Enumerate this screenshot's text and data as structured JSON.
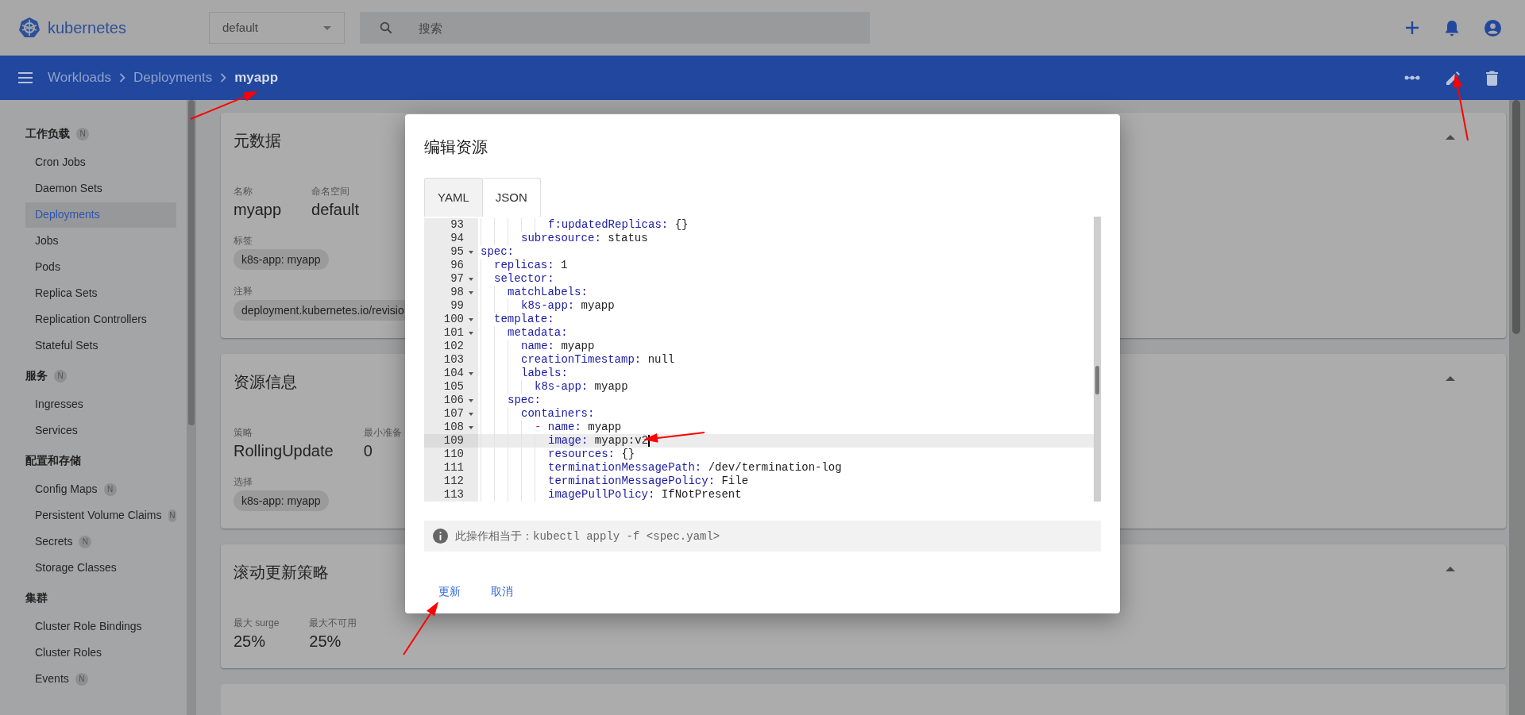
{
  "header": {
    "logo_text": "kubernetes",
    "namespace": "default",
    "search": {
      "placeholder": "搜索"
    }
  },
  "toolbar": {
    "breadcrumbs": [
      {
        "label": "Workloads",
        "current": false
      },
      {
        "label": "Deployments",
        "current": false
      },
      {
        "label": "myapp",
        "current": true
      }
    ]
  },
  "sidebar": {
    "sections": [
      {
        "title": "工作负载",
        "badge": "N",
        "items": [
          {
            "label": "Cron Jobs",
            "selected": false
          },
          {
            "label": "Daemon Sets",
            "selected": false
          },
          {
            "label": "Deployments",
            "selected": true
          },
          {
            "label": "Jobs",
            "selected": false
          },
          {
            "label": "Pods",
            "selected": false
          },
          {
            "label": "Replica Sets",
            "selected": false
          },
          {
            "label": "Replication Controllers",
            "selected": false
          },
          {
            "label": "Stateful Sets",
            "selected": false
          }
        ]
      },
      {
        "title": "服务",
        "badge": "N",
        "items": [
          {
            "label": "Ingresses",
            "selected": false
          },
          {
            "label": "Services",
            "selected": false
          }
        ]
      },
      {
        "title": "配置和存储",
        "items": [
          {
            "label": "Config Maps",
            "selected": false,
            "badge": "N"
          },
          {
            "label": "Persistent Volume Claims",
            "selected": false,
            "badge": "N"
          },
          {
            "label": "Secrets",
            "selected": false,
            "badge": "N"
          },
          {
            "label": "Storage Classes",
            "selected": false
          }
        ]
      },
      {
        "title": "集群",
        "items": [
          {
            "label": "Cluster Role Bindings",
            "selected": false
          },
          {
            "label": "Cluster Roles",
            "selected": false
          },
          {
            "label": "Events",
            "selected": false,
            "badge": "N"
          }
        ]
      }
    ]
  },
  "cards": [
    {
      "title": "元数据",
      "fields": [
        {
          "label": "名称",
          "value": "myapp"
        },
        {
          "label": "命名空间",
          "value": "default"
        }
      ],
      "chip_groups": [
        {
          "label": "标签",
          "chips": [
            "k8s-app: myapp"
          ]
        },
        {
          "label": "注释",
          "chips": [
            "deployment.kubernetes.io/revisio"
          ]
        }
      ]
    },
    {
      "title": "资源信息",
      "fields": [
        {
          "label": "策略",
          "value": "RollingUpdate"
        },
        {
          "label": "最小准备",
          "value": "0"
        }
      ],
      "chip_groups": [
        {
          "label": "选择",
          "chips": [
            "k8s-app: myapp"
          ]
        }
      ]
    },
    {
      "title": "滚动更新策略",
      "fields": [
        {
          "label": "最大 surge",
          "value": "25%"
        },
        {
          "label": "最大不可用",
          "value": "25%"
        }
      ]
    }
  ],
  "dialog": {
    "title": "编辑资源",
    "tabs": [
      {
        "label": "YAML",
        "selected": false
      },
      {
        "label": "JSON",
        "selected": true
      }
    ],
    "lines": [
      {
        "children": [
          {
            "children": [
              {
                "children": [
                  {
                    "children": [
                      {
                        "children": [
                          {
                            "num": "93",
                            "key": "f:updatedReplicas:",
                            "value": "{}",
                            "fold": false,
                            "selected": false
                          }
                        ]
                      }
                    ]
                  },
                  {
                    "num": "94",
                    "key": "subresource:",
                    "value": "status",
                    "fold": false,
                    "selected": false
                  }
                ]
              }
            ]
          }
        ]
      },
      {
        "num": "95",
        "key": "spec:",
        "fold": true,
        "selected": false,
        "children": [
          {
            "num": "96",
            "key": "replicas:",
            "value": "1",
            "fold": false,
            "selected": false
          },
          {
            "num": "97",
            "key": "selector:",
            "fold": true,
            "selected": false,
            "children": [
              {
                "num": "98",
                "key": "matchLabels:",
                "fold": true,
                "selected": false,
                "children": [
                  {
                    "num": "99",
                    "key": "k8s-app:",
                    "value": "myapp",
                    "fold": false,
                    "selected": false
                  }
                ]
              }
            ]
          },
          {
            "num": "100",
            "key": "template:",
            "fold": true,
            "selected": false,
            "children": [
              {
                "num": "101",
                "key": "metadata:",
                "fold": true,
                "selected": false,
                "children": [
                  {
                    "num": "102",
                    "key": "name:",
                    "value": "myapp",
                    "fold": false,
                    "selected": false
                  },
                  {
                    "num": "103",
                    "key": "creationTimestamp:",
                    "value": "null",
                    "fold": false,
                    "selected": false
                  },
                  {
                    "num": "104",
                    "key": "labels:",
                    "fold": true,
                    "selected": false,
                    "children": [
                      {
                        "num": "105",
                        "key": "k8s-app:",
                        "value": "myapp",
                        "fold": false,
                        "selected": false
                      }
                    ]
                  }
                ]
              },
              {
                "num": "106",
                "key": "spec:",
                "fold": true,
                "selected": false,
                "children": [
                  {
                    "num": "107",
                    "key": "containers:",
                    "fold": true,
                    "selected": false,
                    "children": [
                      {
                        "num": "108",
                        "dash": "-",
                        "key": "name:",
                        "value": "myapp",
                        "fold": true,
                        "selected": false,
                        "children": [
                          {
                            "num": "109",
                            "key": "image:",
                            "value": "myapp:v2",
                            "fold": false,
                            "selected": true
                          },
                          {
                            "num": "110",
                            "key": "resources:",
                            "value": "{}",
                            "fold": false,
                            "selected": false
                          },
                          {
                            "num": "111",
                            "key": "terminationMessagePath:",
                            "value": "/dev/termination-log",
                            "fold": false,
                            "selected": false
                          },
                          {
                            "num": "112",
                            "key": "terminationMessagePolicy:",
                            "value": "File",
                            "fold": false,
                            "selected": false
                          },
                          {
                            "num": "113",
                            "key": "imagePullPolicy:",
                            "value": "IfNotPresent",
                            "fold": false,
                            "selected": false
                          }
                        ]
                      }
                    ]
                  }
                ]
              }
            ]
          }
        ]
      }
    ],
    "info": {
      "text": "此操作相当于：",
      "command": "kubectl apply -f <spec.yaml>"
    },
    "buttons": [
      "更新",
      "取消"
    ]
  }
}
